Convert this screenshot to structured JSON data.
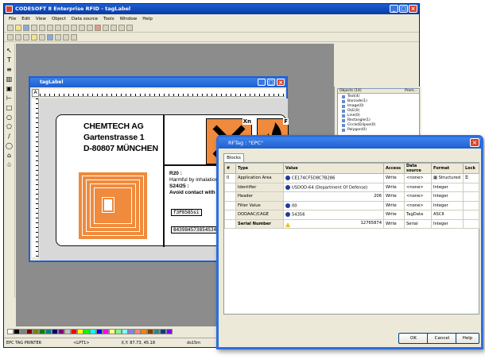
{
  "main_window": {
    "title": "CODESOFT 8 Enterprise RFID - tagLabel",
    "menu": [
      "File",
      "Edit",
      "View",
      "Object",
      "Data source",
      "Tools",
      "Window",
      "Help"
    ]
  },
  "objects_panel": {
    "header": "Objects (14)",
    "header_btn": "Prem...",
    "items": [
      "Text(4)",
      "Barcode(1)",
      "Image(0)",
      "OLE(0)",
      "Line(0)",
      "Rectangle(1)",
      "Circle(Ellipse(0)",
      "Polygon(0)"
    ]
  },
  "status_bar": {
    "printer": "EPC TAG PRINTER",
    "port": "<LPT1>",
    "coords": "X,Y: 87.73, 45.18",
    "extra": "ds15m"
  },
  "doc_window": {
    "title": "tagLabel",
    "company": [
      "CHEMTECH AG",
      "Gartenstrasse 1",
      "D-80807 MÜNCHEN"
    ],
    "hazard_code_1": "Xn",
    "hazard_code_2": "F",
    "r_code": "R20 :",
    "r_text": "Harmful by inhalation.",
    "s_code": "S24/25 :",
    "s_text": "Avoid contact with skin and",
    "barcode_1": "f3P8585si",
    "barcode_2": "843984573854S3459R704"
  },
  "dialog": {
    "title": "RFTag : \"EPC\"",
    "tab": "Blocks",
    "columns": [
      "#",
      "Type",
      "Value",
      "Access",
      "Data source",
      "Format",
      "Lock"
    ],
    "rows": [
      {
        "num": "0",
        "type": "Application Area",
        "value": "CE174CF5D8C7B286",
        "access": "Write",
        "source": "<none>",
        "format": "Structured",
        "lock": ""
      },
      {
        "num": "",
        "type": "Identifier",
        "value": "USDOD-64 (Department Of Defense)",
        "access": "Write",
        "source": "<none>",
        "format": "Integer",
        "lock": ""
      },
      {
        "num": "",
        "type": "Header",
        "value": "206",
        "access": "Write",
        "source": "<none>",
        "format": "Integer",
        "lock": ""
      },
      {
        "num": "",
        "type": "Filter Value",
        "value": "00",
        "access": "Write",
        "source": "<none>",
        "format": "Integer",
        "lock": ""
      },
      {
        "num": "",
        "type": "DODAAC/CAGE",
        "value": "54356",
        "access": "Write",
        "source": "TagData",
        "format": "ASCII",
        "lock": ""
      },
      {
        "num": "",
        "type": "Serial Number",
        "value": "12765874",
        "access": "Write",
        "source": "Serial",
        "format": "Integer",
        "lock": ""
      }
    ],
    "buttons": {
      "ok": "OK",
      "cancel": "Cancel",
      "help": "Help"
    }
  },
  "colors": {
    "label_orange": "#f08a3c",
    "xp_blue": "#1d5fd1",
    "dialog_bg": "#ece9d8"
  }
}
